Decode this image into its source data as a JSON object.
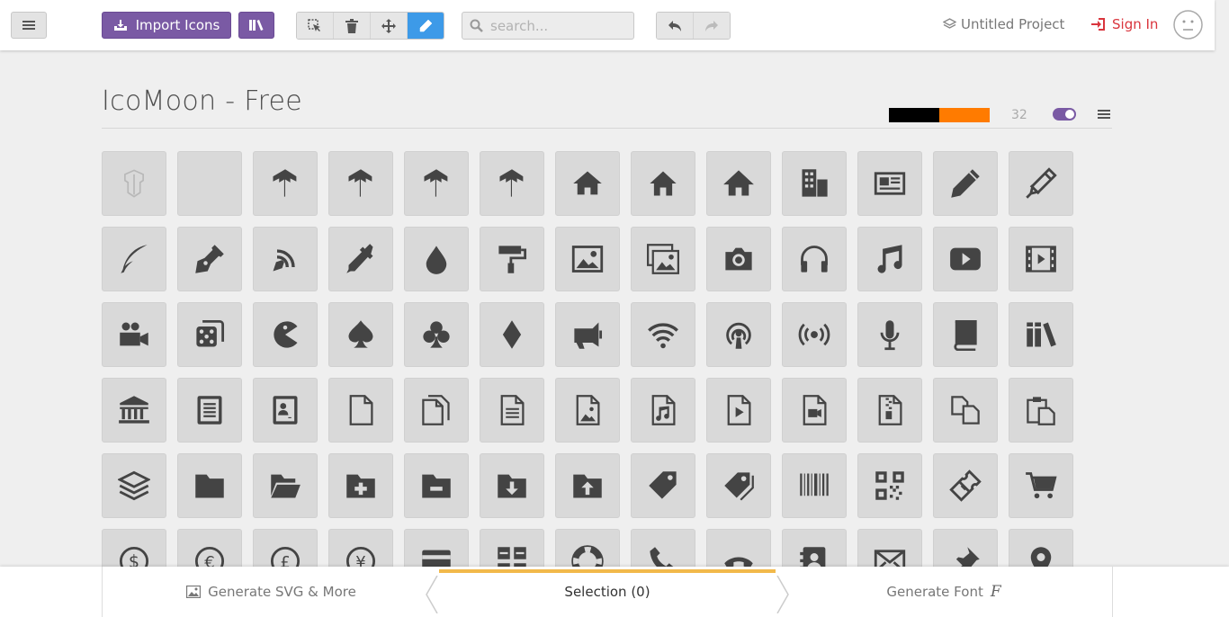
{
  "header": {
    "import_label": "Import Icons",
    "search_placeholder": "search...",
    "project_label": "Untitled Project",
    "signin_label": "Sign In"
  },
  "set": {
    "title": "IcoMoon - Free",
    "size": "32",
    "colors": [
      "#000000",
      "#ff7b00"
    ],
    "toggle_on": true
  },
  "icons": [
    [
      "icomoon-ghost",
      "blank",
      "tf",
      "tf",
      "tf",
      "tf",
      "home",
      "home2",
      "home3",
      "office",
      "newspaper",
      "pencil",
      "pencil2"
    ],
    [
      "quill",
      "pen",
      "blog",
      "eyedropper",
      "droplet",
      "paint-format",
      "image",
      "images",
      "camera",
      "headphones",
      "music",
      "play",
      "film"
    ],
    [
      "video-camera",
      "dice",
      "pacman",
      "spades",
      "clubs",
      "diamonds",
      "bullhorn",
      "connection",
      "podcast",
      "feed",
      "mic",
      "book",
      "books"
    ],
    [
      "library",
      "file-text",
      "profile",
      "file-empty",
      "files-empty",
      "file-text2",
      "file-picture",
      "file-music",
      "file-play",
      "file-video",
      "file-zip",
      "copy",
      "paste"
    ],
    [
      "stack",
      "folder",
      "folder-open",
      "folder-plus",
      "folder-minus",
      "folder-download",
      "folder-upload",
      "price-tag",
      "price-tags",
      "barcode",
      "qrcode",
      "ticket",
      "cart"
    ],
    [
      "coin-dollar",
      "coin-euro",
      "coin-pound",
      "coin-yen",
      "credit-card",
      "calculator",
      "lifebuoy",
      "phone",
      "phone-hang-up",
      "address-book",
      "envelop",
      "pushpin",
      "location"
    ]
  ],
  "footer": {
    "generate_svg_label": "Generate SVG & More",
    "selection_label": "Selection (0)",
    "generate_font_label": "Generate Font",
    "font_glyph": "F"
  }
}
